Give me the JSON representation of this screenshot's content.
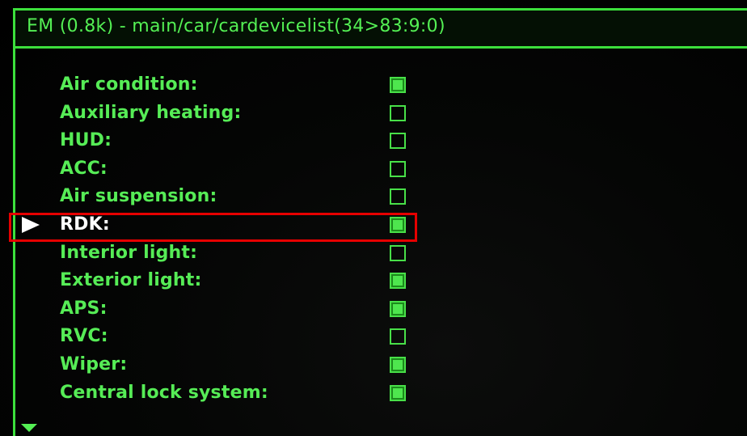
{
  "window": {
    "title": "EM (0.8k) - main/car/cardevicelist(34>83:9:0)"
  },
  "colors": {
    "accent": "#3ce03c",
    "text": "#56ec56",
    "selected_text": "#ffffff",
    "highlight": "#e60000",
    "background": "#000000"
  },
  "list": {
    "selected_index": 5,
    "items": [
      {
        "label": "Air condition:",
        "checked": true
      },
      {
        "label": "Auxiliary heating:",
        "checked": false
      },
      {
        "label": "HUD:",
        "checked": false
      },
      {
        "label": "ACC:",
        "checked": false
      },
      {
        "label": "Air suspension:",
        "checked": false
      },
      {
        "label": "RDK:",
        "checked": true
      },
      {
        "label": "Interior light:",
        "checked": false
      },
      {
        "label": "Exterior light:",
        "checked": true
      },
      {
        "label": "APS:",
        "checked": true
      },
      {
        "label": "RVC:",
        "checked": false
      },
      {
        "label": "Wiper:",
        "checked": true
      },
      {
        "label": "Central lock system:",
        "checked": true
      }
    ]
  },
  "icons": {
    "selector": "triangle-right-icon",
    "scroll": "triangle-down-icon"
  }
}
